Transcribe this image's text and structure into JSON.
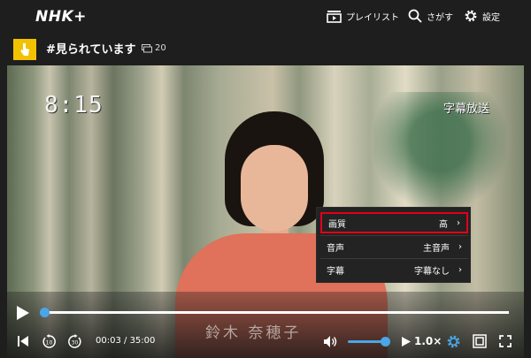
{
  "header": {
    "logo": "NHK+",
    "nav": {
      "playlist": "プレイリスト",
      "search": "さがす",
      "settings": "設定"
    }
  },
  "program": {
    "title": "#見られています",
    "comment_count": "20"
  },
  "video": {
    "clock": "8:15",
    "caption_tag": "字幕放送",
    "name_caption": "鈴木 奈穂子"
  },
  "settings_menu": {
    "items": [
      {
        "label": "画質",
        "value": "高",
        "selected": true
      },
      {
        "label": "音声",
        "value": "主音声",
        "selected": false
      },
      {
        "label": "字幕",
        "value": "字幕なし",
        "selected": false
      }
    ]
  },
  "player": {
    "time_current": "00:03",
    "time_separator": " / ",
    "time_total": "35:00",
    "speed": "1.0×",
    "progress_fraction": 0.0014,
    "volume_fraction": 0.8,
    "accent_color": "#4aa6e8",
    "selected_outline_color": "#e1001a"
  }
}
